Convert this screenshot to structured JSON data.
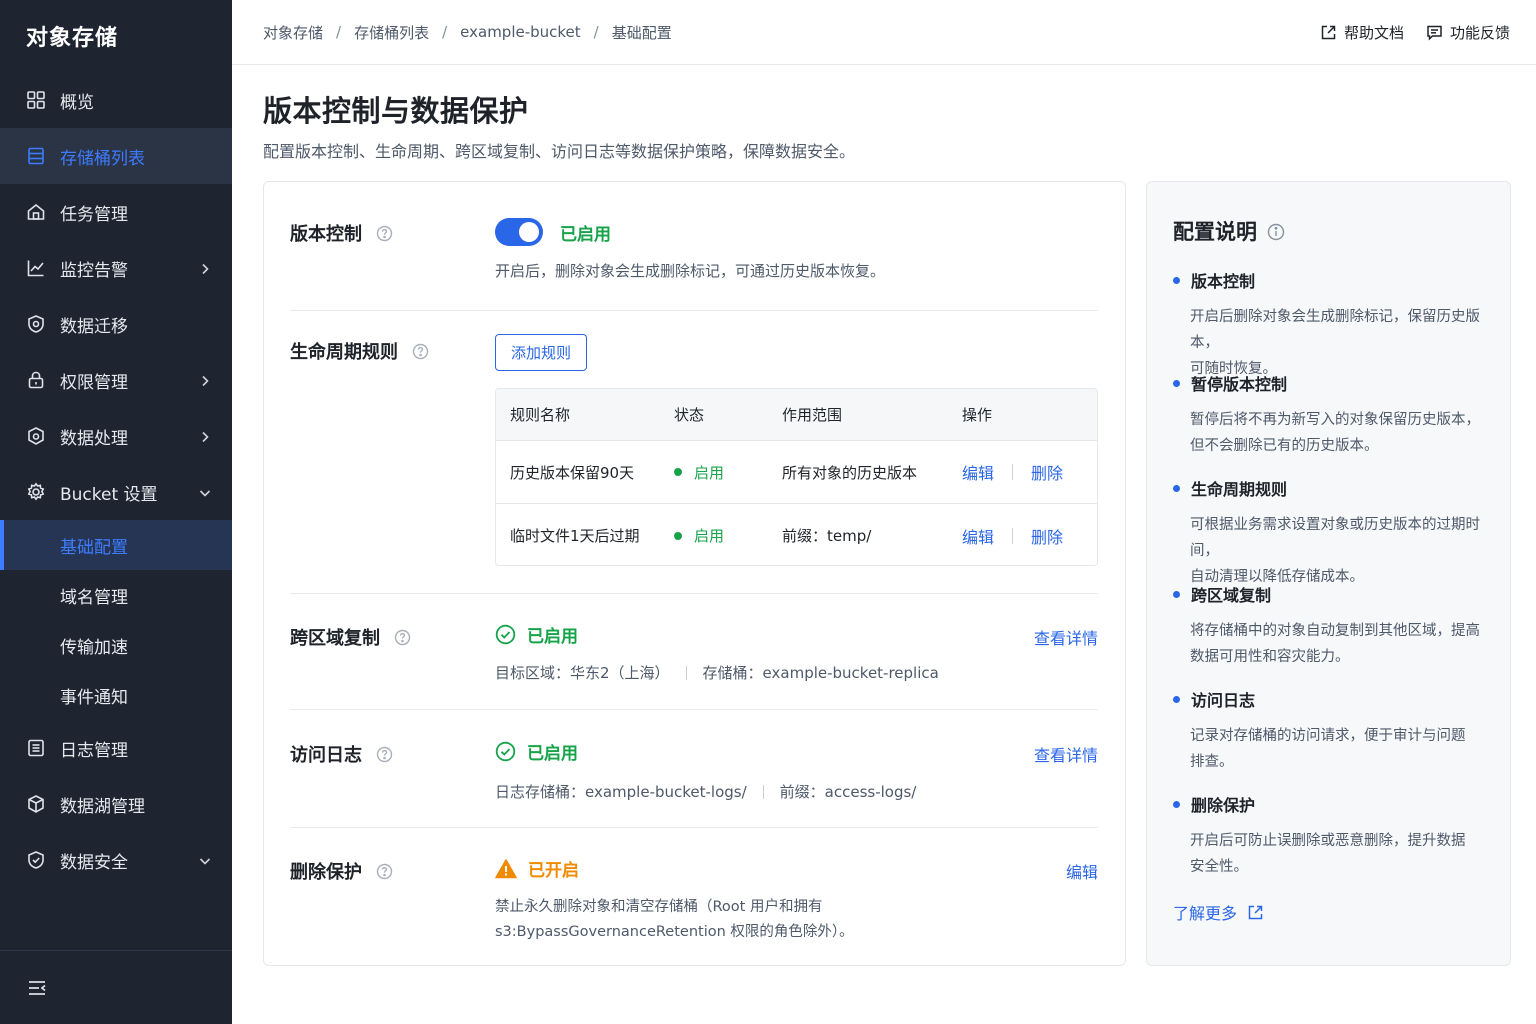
{
  "sidebar": {
    "brand": "对象存储",
    "items": [
      {
        "label": "概览",
        "icon": "grid-icon"
      },
      {
        "label": "存储桶列表",
        "icon": "list-icon"
      },
      {
        "label": "任务管理",
        "icon": "home-icon"
      },
      {
        "label": "监控告警",
        "icon": "chart-icon"
      },
      {
        "label": "数据迁移",
        "icon": "shield-icon"
      },
      {
        "label": "权限管理",
        "icon": "lock-icon"
      },
      {
        "label": "数据处理",
        "icon": "cube-icon"
      },
      {
        "label": "Bucket 设置",
        "icon": "gear-icon"
      },
      {
        "label": "日志管理",
        "icon": "log-icon"
      },
      {
        "label": "数据湖管理",
        "icon": "lake-icon"
      },
      {
        "label": "数据安全",
        "icon": "security-icon"
      }
    ],
    "sub_items": [
      "基础配置",
      "域名管理",
      "传输加速",
      "事件通知"
    ]
  },
  "breadcrumb": [
    "对象存储",
    "存储桶列表",
    "example-bucket",
    "基础配置"
  ],
  "top_links": {
    "help": "帮助文档",
    "feedback": "功能反馈"
  },
  "page": {
    "title": "版本控制与数据保护",
    "desc": "配置版本控制、生命周期、跨区域复制、访问日志等数据保护策略，保障数据安全。"
  },
  "versioning": {
    "label": "版本控制",
    "status": "已启用",
    "enabled": true,
    "desc": "开启后，删除对象会生成删除标记，可通过历史版本恢复。"
  },
  "lifecycle": {
    "label": "生命周期规则",
    "add_button": "添加规则",
    "columns": [
      "规则名称",
      "状态",
      "作用范围",
      "操作"
    ],
    "rows": [
      {
        "name": "历史版本保留90天",
        "status": "启用",
        "scope": "所有对象的历史版本",
        "edit": "编辑",
        "delete": "删除"
      },
      {
        "name": "临时文件1天后过期",
        "status": "启用",
        "scope": "前缀：temp/",
        "edit": "编辑",
        "delete": "删除"
      }
    ]
  },
  "replication": {
    "label": "跨区域复制",
    "status": "已启用",
    "link": "查看详情",
    "meta1": "目标区域：华东2（上海）",
    "meta2": "存储桶：example-bucket-replica"
  },
  "access_log": {
    "label": "访问日志",
    "status": "已启用",
    "link": "查看详情",
    "meta1": "日志存储桶：example-bucket-logs/",
    "meta2": "前缀：access-logs/"
  },
  "delete_protection": {
    "label": "删除保护",
    "status": "已开启",
    "link": "编辑",
    "desc_line1": "禁止永久删除对象和清空存储桶（Root 用户和拥有",
    "desc_line2": "s3:BypassGovernanceRetention 权限的角色除外）。"
  },
  "panel": {
    "title": "配置说明",
    "tips": [
      {
        "title": "版本控制",
        "line1": "开启后删除对象会生成删除标记，保留历史版本，",
        "line2": "可随时恢复。"
      },
      {
        "title": "暂停版本控制",
        "line1": "暂停后将不再为新写入的对象保留历史版本，",
        "line2": "但不会删除已有的历史版本。"
      },
      {
        "title": "生命周期规则",
        "line1": "可根据业务需求设置对象或历史版本的过期时间，",
        "line2": "自动清理以降低存储成本。"
      },
      {
        "title": "跨区域复制",
        "line1": "将存储桶中的对象自动复制到其他区域，提高",
        "line2": "数据可用性和容灾能力。"
      },
      {
        "title": "访问日志",
        "line1": "记录对存储桶的访问请求，便于审计与问题",
        "line2": "排查。"
      },
      {
        "title": "删除保护",
        "line1": "开启后可防止误删除或恶意删除，提升数据",
        "line2": "安全性。"
      }
    ],
    "learn_more": "了解更多"
  },
  "colors": {
    "accent": "#2a66e8",
    "success": "#17a34a",
    "warning": "#f08a00",
    "sidebar_bg": "#1e2531"
  }
}
